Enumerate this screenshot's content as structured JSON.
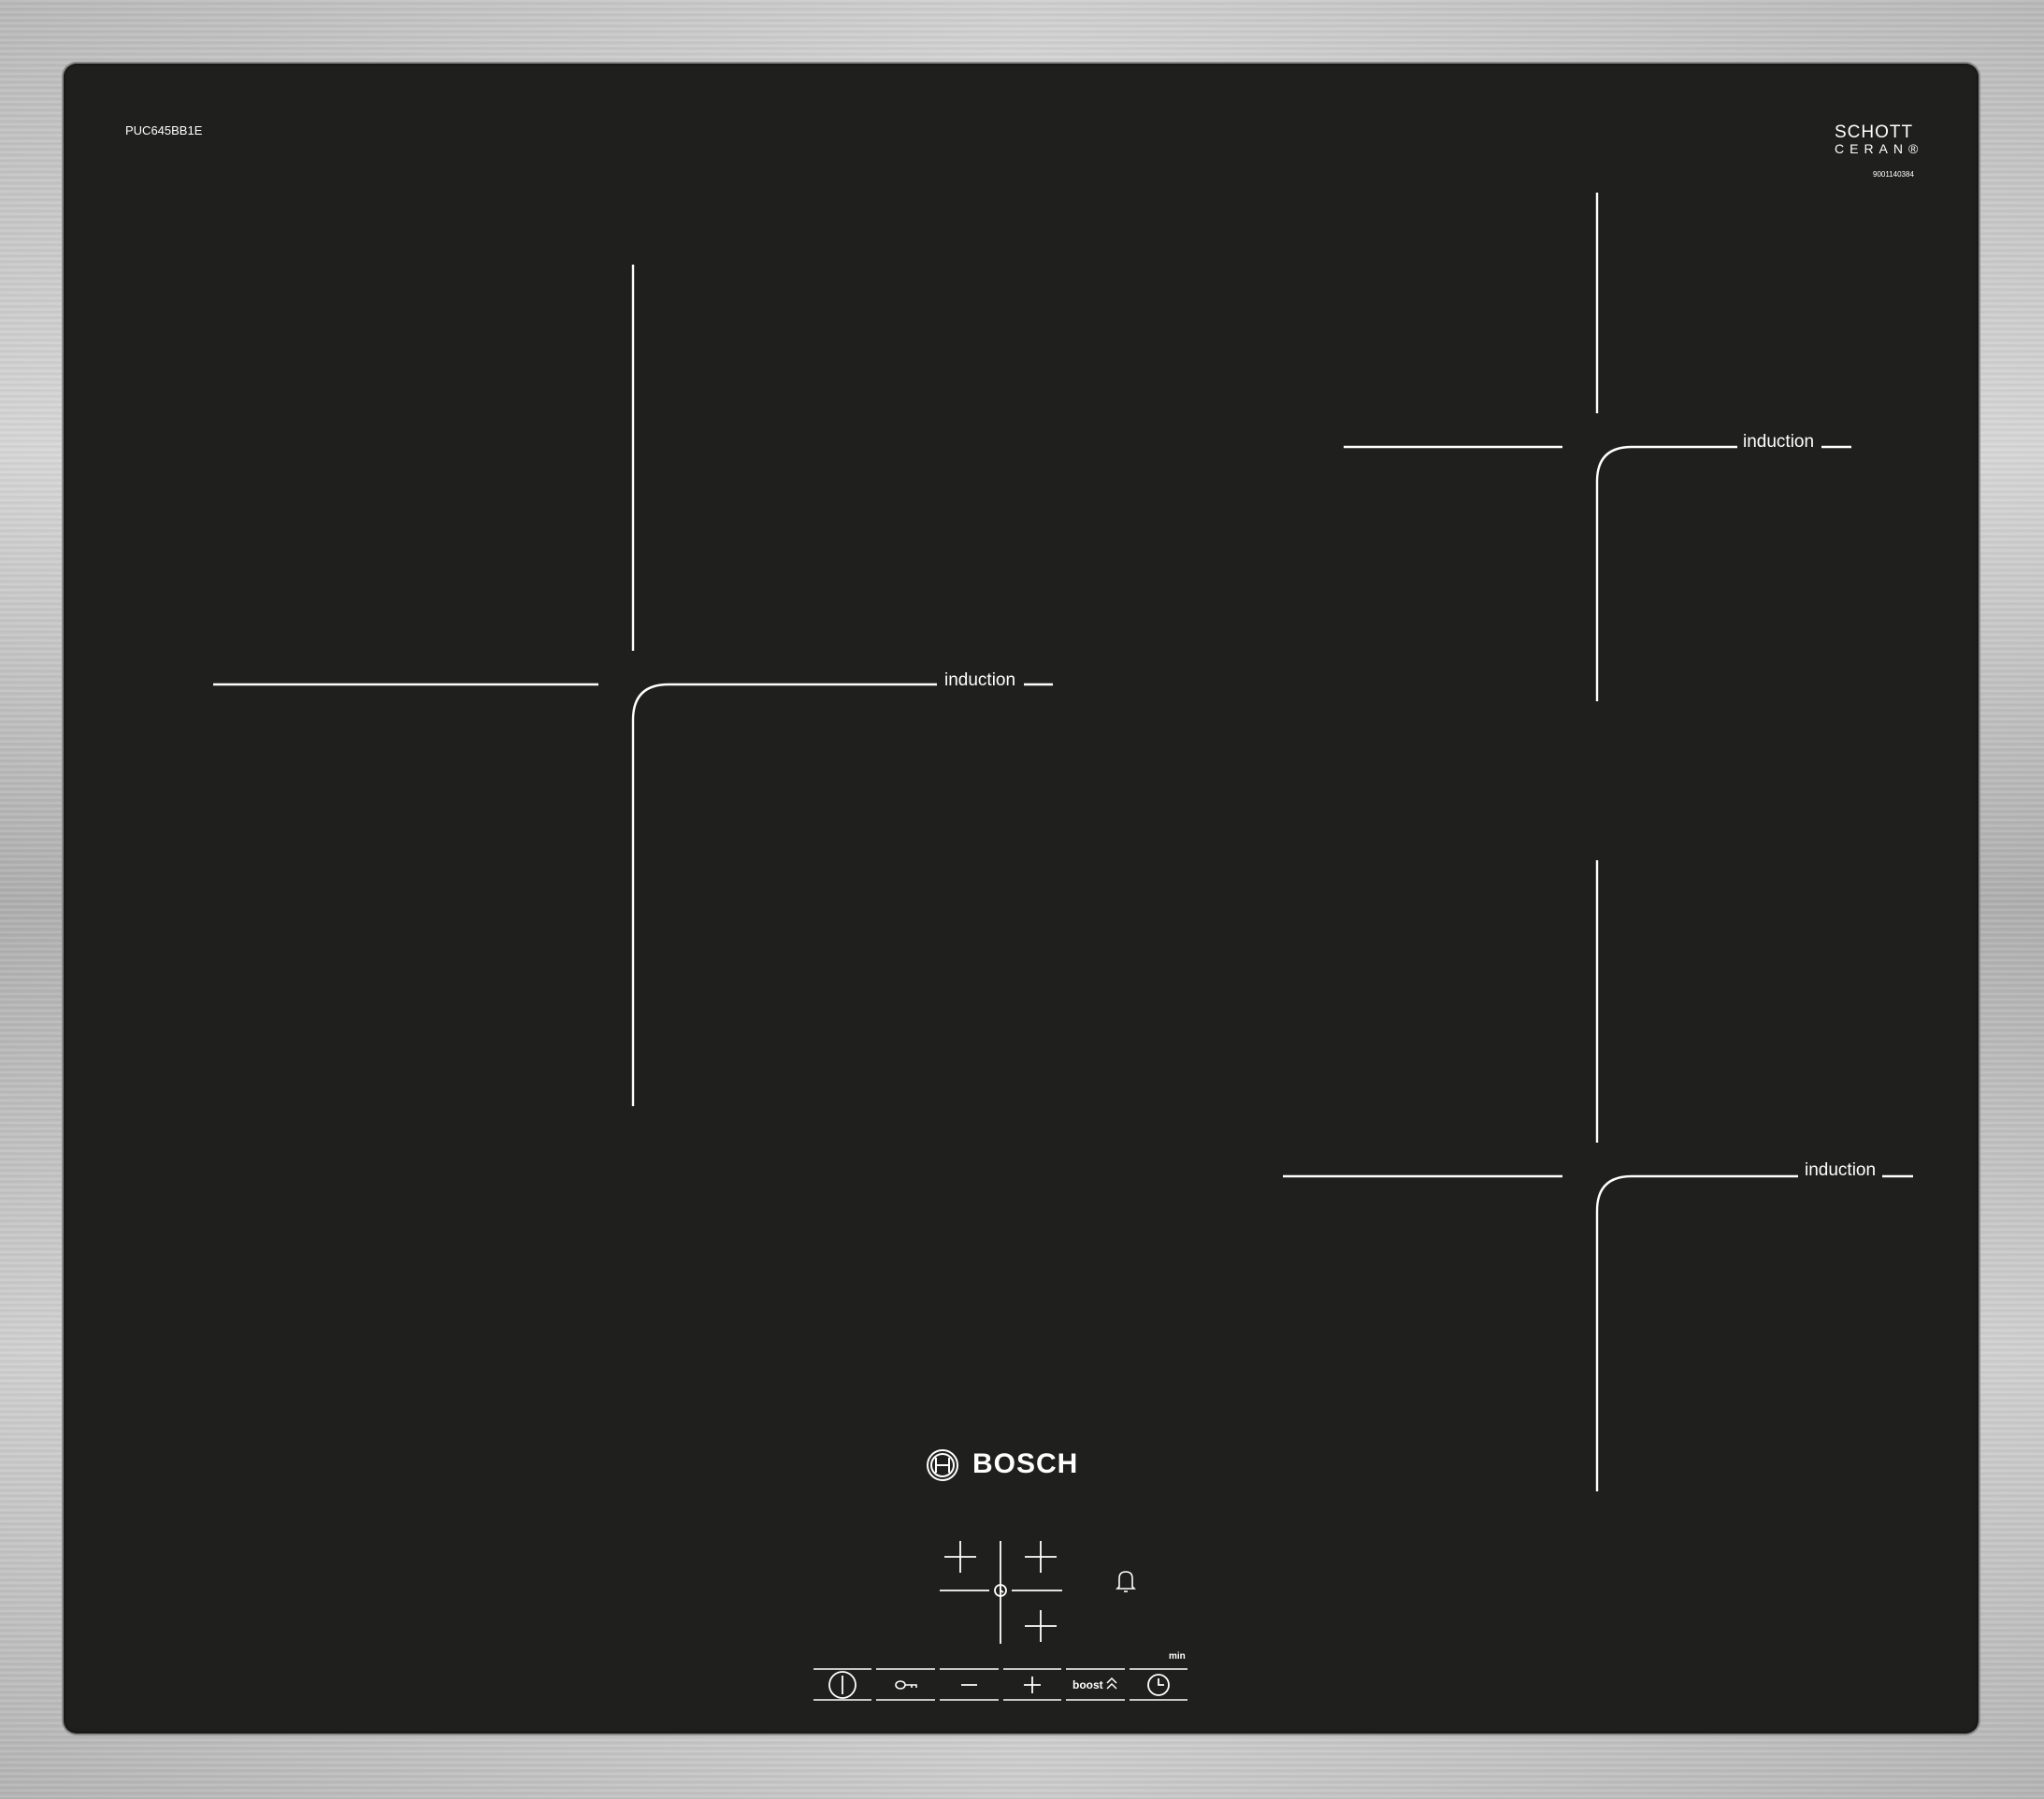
{
  "cooktop": {
    "model_number": "PUC645BB1E",
    "brand": "BOSCH",
    "glass_brand_top": "SCHOTT",
    "glass_brand_bottom": "CERAN",
    "glass_registered_mark": "®",
    "glass_code": "9001140384",
    "zones": [
      {
        "id": "left",
        "label": "induction"
      },
      {
        "id": "top-right",
        "label": "induction"
      },
      {
        "id": "bottom-right",
        "label": "induction"
      }
    ],
    "controls": {
      "boost_label": "boost",
      "timer_unit_label": "min",
      "buttons": [
        "power",
        "child-lock",
        "minus",
        "plus",
        "boost",
        "timer"
      ]
    },
    "colors": {
      "glass": "#1f1f1e",
      "markings": "#ffffff",
      "frame": "#cfcfcf"
    }
  }
}
